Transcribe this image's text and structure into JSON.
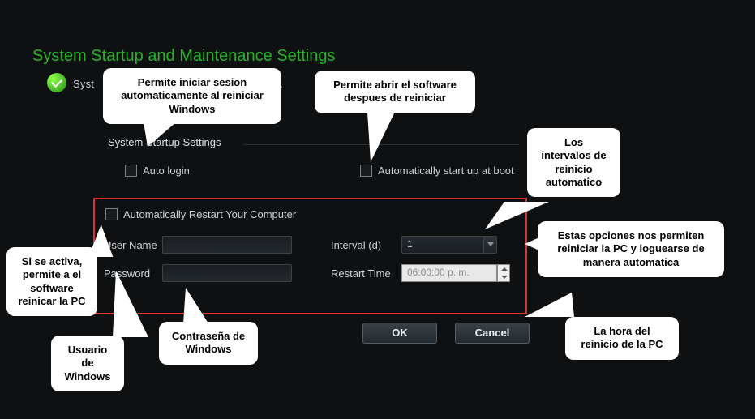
{
  "title": "System Startup and Maintenance Settings",
  "subtitle_prefix": "Syst",
  "subtitle_suffix": "ngs.",
  "section_header": "System Startup Settings",
  "checkboxes": {
    "auto_login": "Auto login",
    "auto_start_boot": "Automatically start up at boot",
    "auto_restart": "Automatically Restart Your Computer"
  },
  "fields": {
    "username_label": "User Name",
    "username_value": "",
    "password_label": "Password",
    "password_value": "",
    "interval_label": "Interval (d)",
    "interval_value": "1",
    "restart_time_label": "Restart Time",
    "restart_time_value": "06:00:00 p. m."
  },
  "buttons": {
    "ok": "OK",
    "cancel": "Cancel"
  },
  "callouts": {
    "c1": "Permite iniciar sesion automaticamente al reiniciar Windows",
    "c2": "Permite abrir el software despues de reiniciar",
    "c3": "Los intervalos de reinicio automatico",
    "c4": "Estas opciones nos permiten reiniciar la PC y loguearse de manera automatica",
    "c5": "Si se activa, permite a el software reinicar la PC",
    "c6": "Usuario de Windows",
    "c7": "Contraseña de Windows",
    "c8": "La hora del reinicio de la PC"
  }
}
